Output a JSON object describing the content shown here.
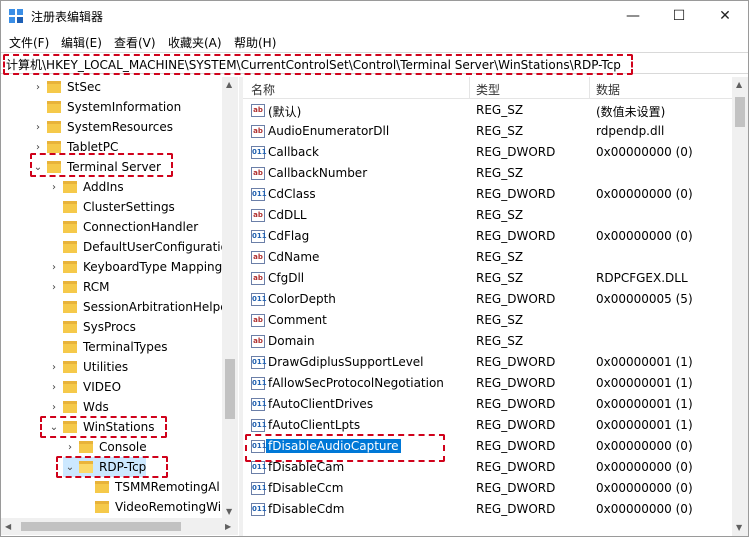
{
  "window": {
    "title": "注册表编辑器",
    "minimize": "—",
    "maximize": "☐",
    "close": "✕"
  },
  "menu": [
    "文件(F)",
    "编辑(E)",
    "查看(V)",
    "收藏夹(A)",
    "帮助(H)"
  ],
  "address": "计算机\\HKEY_LOCAL_MACHINE\\SYSTEM\\CurrentControlSet\\Control\\Terminal Server\\WinStations\\RDP-Tcp",
  "tree": [
    {
      "label": "StSec",
      "chev": "›",
      "open": false
    },
    {
      "label": "SystemInformation",
      "chev": "",
      "open": false
    },
    {
      "label": "SystemResources",
      "chev": "›",
      "open": false
    },
    {
      "label": "TabletPC",
      "chev": "›",
      "open": false
    },
    {
      "label": "Terminal Server",
      "chev": "⌄",
      "open": false
    },
    {
      "label": "AddIns",
      "chev": "›",
      "open": false
    },
    {
      "label": "ClusterSettings",
      "chev": "",
      "open": false
    },
    {
      "label": "ConnectionHandler",
      "chev": "",
      "open": false
    },
    {
      "label": "DefaultUserConfiguratio",
      "chev": "",
      "open": false
    },
    {
      "label": "KeyboardType Mapping",
      "chev": "›",
      "open": false
    },
    {
      "label": "RCM",
      "chev": "›",
      "open": false
    },
    {
      "label": "SessionArbitrationHelpe",
      "chev": "",
      "open": false
    },
    {
      "label": "SysProcs",
      "chev": "",
      "open": false
    },
    {
      "label": "TerminalTypes",
      "chev": "",
      "open": false
    },
    {
      "label": "Utilities",
      "chev": "›",
      "open": false
    },
    {
      "label": "VIDEO",
      "chev": "›",
      "open": false
    },
    {
      "label": "Wds",
      "chev": "›",
      "open": false
    },
    {
      "label": "WinStations",
      "chev": "⌄",
      "open": false
    },
    {
      "label": "Console",
      "chev": "›",
      "open": false
    },
    {
      "label": "RDP-Tcp",
      "chev": "⌄",
      "open": true
    },
    {
      "label": "TSMMRemotingAl",
      "chev": "",
      "open": false
    },
    {
      "label": "VideoRemotingWi",
      "chev": "",
      "open": false
    }
  ],
  "columns": {
    "name": "名称",
    "type": "类型",
    "data": "数据"
  },
  "values": [
    {
      "name": "(默认)",
      "type": "REG_SZ",
      "data": "(数值未设置)",
      "kind": "sz"
    },
    {
      "name": "AudioEnumeratorDll",
      "type": "REG_SZ",
      "data": "rdpendp.dll",
      "kind": "sz"
    },
    {
      "name": "Callback",
      "type": "REG_DWORD",
      "data": "0x00000000 (0)",
      "kind": "dword"
    },
    {
      "name": "CallbackNumber",
      "type": "REG_SZ",
      "data": "",
      "kind": "sz"
    },
    {
      "name": "CdClass",
      "type": "REG_DWORD",
      "data": "0x00000000 (0)",
      "kind": "dword"
    },
    {
      "name": "CdDLL",
      "type": "REG_SZ",
      "data": "",
      "kind": "sz"
    },
    {
      "name": "CdFlag",
      "type": "REG_DWORD",
      "data": "0x00000000 (0)",
      "kind": "dword"
    },
    {
      "name": "CdName",
      "type": "REG_SZ",
      "data": "",
      "kind": "sz"
    },
    {
      "name": "CfgDll",
      "type": "REG_SZ",
      "data": "RDPCFGEX.DLL",
      "kind": "sz"
    },
    {
      "name": "ColorDepth",
      "type": "REG_DWORD",
      "data": "0x00000005 (5)",
      "kind": "dword"
    },
    {
      "name": "Comment",
      "type": "REG_SZ",
      "data": "",
      "kind": "sz"
    },
    {
      "name": "Domain",
      "type": "REG_SZ",
      "data": "",
      "kind": "sz"
    },
    {
      "name": "DrawGdiplusSupportLevel",
      "type": "REG_DWORD",
      "data": "0x00000001 (1)",
      "kind": "dword"
    },
    {
      "name": "fAllowSecProtocolNegotiation",
      "type": "REG_DWORD",
      "data": "0x00000001 (1)",
      "kind": "dword"
    },
    {
      "name": "fAutoClientDrives",
      "type": "REG_DWORD",
      "data": "0x00000001 (1)",
      "kind": "dword"
    },
    {
      "name": "fAutoClientLpts",
      "type": "REG_DWORD",
      "data": "0x00000001 (1)",
      "kind": "dword"
    },
    {
      "name": "fDisableAudioCapture",
      "type": "REG_DWORD",
      "data": "0x00000000 (0)",
      "kind": "dword"
    },
    {
      "name": "fDisableCam",
      "type": "REG_DWORD",
      "data": "0x00000000 (0)",
      "kind": "dword"
    },
    {
      "name": "fDisableCcm",
      "type": "REG_DWORD",
      "data": "0x00000000 (0)",
      "kind": "dword"
    },
    {
      "name": "fDisableCdm",
      "type": "REG_DWORD",
      "data": "0x00000000 (0)",
      "kind": "dword"
    }
  ],
  "selected_value": "fDisableAudioCapture",
  "accent_color": "#0078d7",
  "highlight_color": "#d0021b"
}
